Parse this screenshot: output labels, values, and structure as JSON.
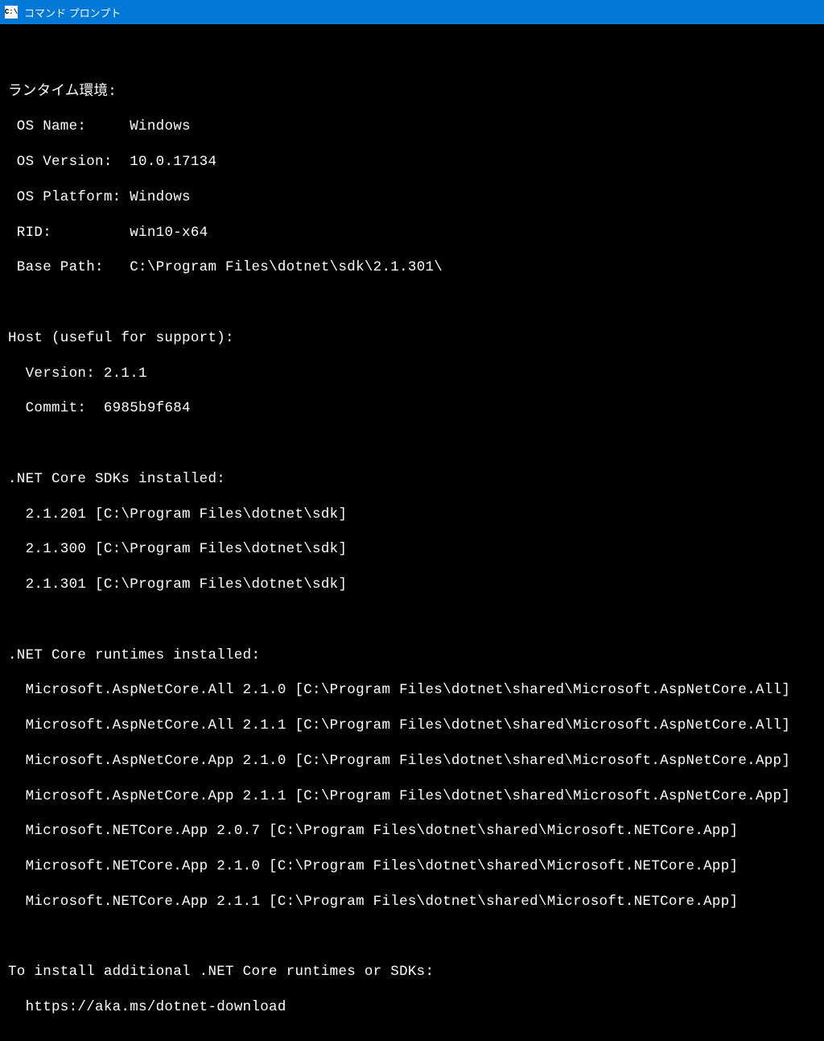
{
  "window": {
    "title": "コマンド プロンプト",
    "icon_label": "C:\\"
  },
  "runtime_header": "ランタイム環境:",
  "runtime": {
    "os_name_label": " OS Name:     ",
    "os_name_value": "Windows",
    "os_version_label": " OS Version:  ",
    "os_version_value": "10.0.17134",
    "os_platform_label": " OS Platform: ",
    "os_platform_value": "Windows",
    "rid_label": " RID:         ",
    "rid_value": "win10-x64",
    "base_path_label": " Base Path:   ",
    "base_path_value": "C:\\Program Files\\dotnet\\sdk\\2.1.301\\"
  },
  "host_header": "Host (useful for support):",
  "host": {
    "version_label": "  Version: ",
    "version_value": "2.1.1",
    "commit_label": "  Commit:  ",
    "commit_value": "6985b9f684"
  },
  "sdks_header": ".NET Core SDKs installed:",
  "sdks": [
    "  2.1.201 [C:\\Program Files\\dotnet\\sdk]",
    "  2.1.300 [C:\\Program Files\\dotnet\\sdk]",
    "  2.1.301 [C:\\Program Files\\dotnet\\sdk]"
  ],
  "runtimes_header": ".NET Core runtimes installed:",
  "runtimes": [
    "  Microsoft.AspNetCore.All 2.1.0 [C:\\Program Files\\dotnet\\shared\\Microsoft.AspNetCore.All]",
    "  Microsoft.AspNetCore.All 2.1.1 [C:\\Program Files\\dotnet\\shared\\Microsoft.AspNetCore.All]",
    "  Microsoft.AspNetCore.App 2.1.0 [C:\\Program Files\\dotnet\\shared\\Microsoft.AspNetCore.App]",
    "  Microsoft.AspNetCore.App 2.1.1 [C:\\Program Files\\dotnet\\shared\\Microsoft.AspNetCore.App]",
    "  Microsoft.NETCore.App 2.0.7 [C:\\Program Files\\dotnet\\shared\\Microsoft.NETCore.App]",
    "  Microsoft.NETCore.App 2.1.0 [C:\\Program Files\\dotnet\\shared\\Microsoft.NETCore.App]",
    "  Microsoft.NETCore.App 2.1.1 [C:\\Program Files\\dotnet\\shared\\Microsoft.NETCore.App]"
  ],
  "footer": {
    "install_msg": "To install additional .NET Core runtimes or SDKs:",
    "url": "  https://aka.ms/dotnet-download"
  }
}
